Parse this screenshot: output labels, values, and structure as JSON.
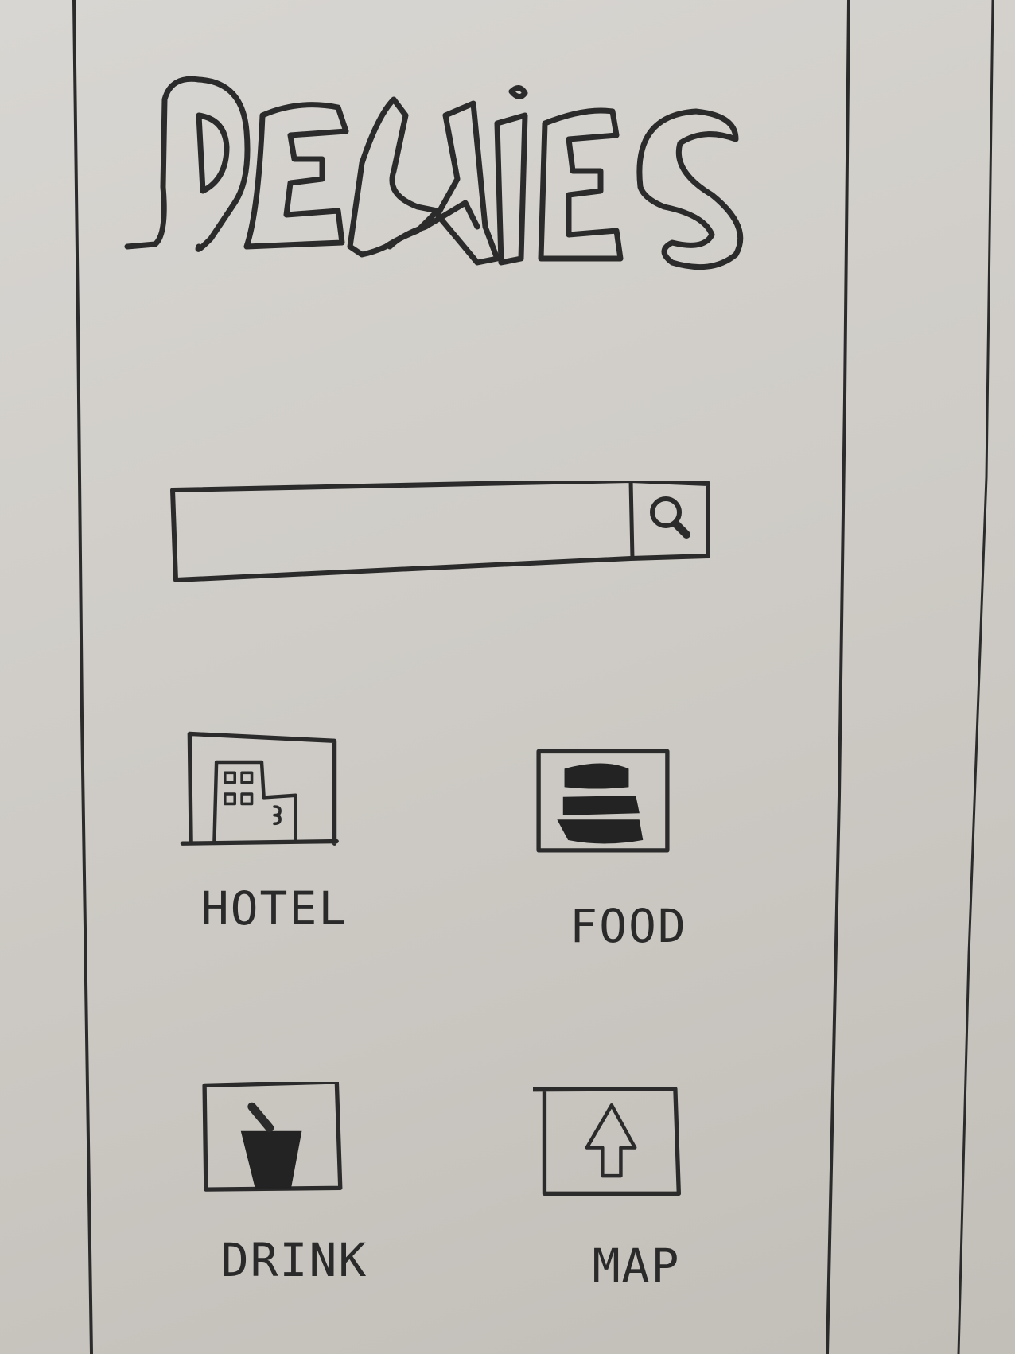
{
  "app": {
    "logo_text": "DEALIES"
  },
  "search": {
    "value": "",
    "placeholder": "",
    "button_icon": "search-icon"
  },
  "categories": [
    {
      "label": "HOTEL",
      "icon": "hotel-building-icon"
    },
    {
      "label": "FOOD",
      "icon": "burger-icon"
    },
    {
      "label": "DRINK",
      "icon": "drink-cup-icon"
    },
    {
      "label": "MAP",
      "icon": "map-arrow-icon"
    }
  ],
  "colors": {
    "ink": "#2b2b2b",
    "paper": "#d2cfca"
  }
}
